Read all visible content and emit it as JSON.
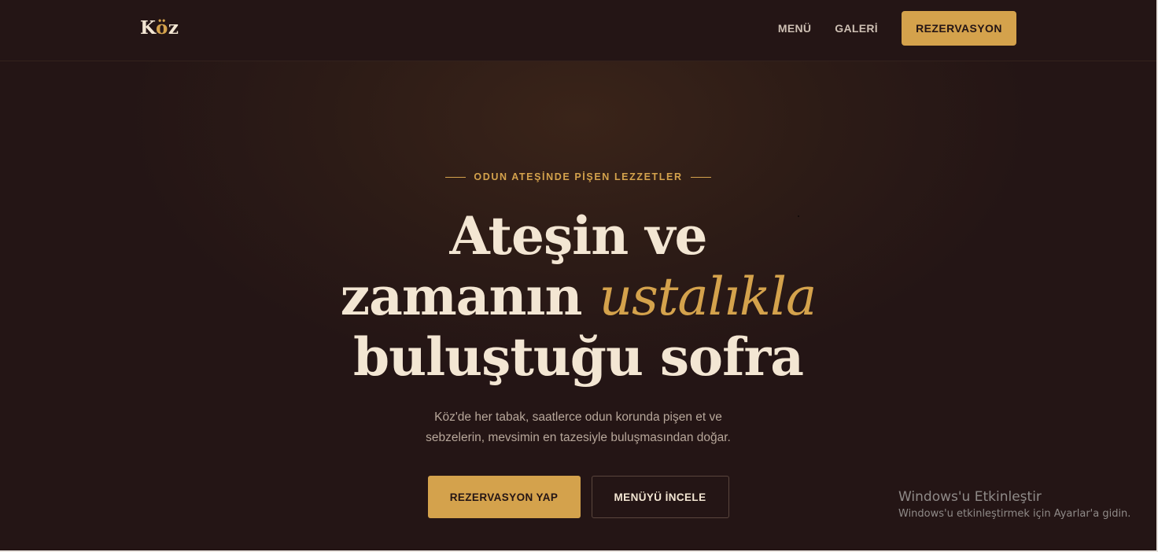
{
  "header": {
    "logo": {
      "prefix": "K",
      "accent": "ö",
      "suffix": "z"
    },
    "nav": [
      {
        "label": "MENÜ"
      },
      {
        "label": "GALERİ"
      }
    ],
    "cta_label": "REZERVASYON"
  },
  "hero": {
    "eyebrow": "ODUN ATEŞİNDE PİŞEN LEZZETLER",
    "headline": {
      "line1": "Ateşin ve",
      "line2_plain": "zamanın ",
      "line2_accent": "ustalıkla",
      "line3": "buluştuğu sofra"
    },
    "subtitle_line1": "Köz'de her tabak, saatlerce odun korunda pişen et ve",
    "subtitle_line2": "sebzelerin, mevsimin en tazesiyle buluşmasından doğar.",
    "primary_button": "REZERVASYON YAP",
    "secondary_button": "MENÜYÜ İNCELE"
  },
  "windows_watermark": {
    "title": "Windows'u Etkinleştir",
    "subtitle": "Windows'u etkinleştirmek için Ayarlar'a gidin."
  },
  "colors": {
    "background": "#241515",
    "accent": "#d4a24c",
    "cream": "#f3e6d3",
    "muted_text": "#b7a79a"
  }
}
